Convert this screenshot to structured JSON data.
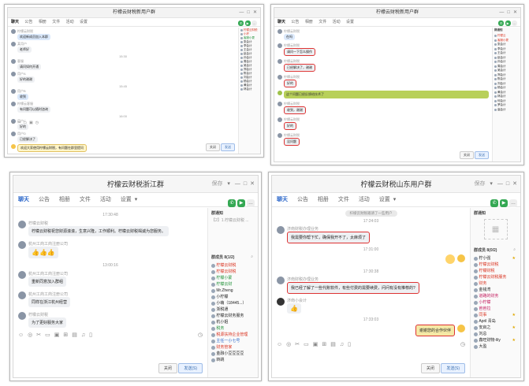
{
  "colors": {
    "accent": "#2a66c9",
    "green": "#34a853",
    "highlight_border": "#dd3333",
    "bubble": "#eef0f3",
    "self_bubble": "#f5e9a6"
  },
  "panel1": {
    "title": "柠檬云财税新用户群",
    "tabs": [
      "聊天",
      "公告",
      "相册",
      "文件",
      "活动",
      "设置"
    ],
    "timestamps": [
      "15:30",
      "15:45",
      "16:00"
    ],
    "messages": [
      {
        "name": "柠檬云财税",
        "text": "欢迎新成员加入本群"
      },
      {
        "name": "某用户",
        "text": "老师好"
      },
      {
        "name": "客服",
        "text": "请问如何开通"
      },
      {
        "name": "用户A",
        "text": "好的谢谢"
      },
      {
        "name": "用户B",
        "text": "收到"
      },
      {
        "name": "柠檬云客服",
        "text": "有问题可以随时咨询"
      },
      {
        "name": "用户C",
        "text": "好的"
      },
      {
        "name": "用户D",
        "text": "已经解决了"
      },
      {
        "name": "柠檬云",
        "text": "欢迎大家使用柠檬云财税，有问题在群里提问"
      }
    ],
    "members": [
      "柠檬云财税",
      "小柠",
      "客服小蒙",
      "张会计",
      "李会计",
      "王会计",
      "赵会计",
      "孙会计",
      "周会计",
      "吴会计",
      "郑会计",
      "陈会计",
      "刘会计",
      "杨会计",
      "黄会计",
      "林会计"
    ],
    "buttons": {
      "close": "关闭",
      "send": "发送"
    }
  },
  "panel2": {
    "title": "柠檬云财税新用户群",
    "tabs": [
      "聊天",
      "公告",
      "相册",
      "文件",
      "活动",
      "设置"
    ],
    "notice_title": "群通知",
    "messages": [
      {
        "name": "柠檬云财税",
        "text": "在吗"
      },
      {
        "name": "柠檬云财税",
        "text": "请问一下怎么操作"
      },
      {
        "name": "柠檬云财税",
        "text": "已经解决了，谢谢"
      },
      {
        "name": "柠檬云财税",
        "text": "好的"
      },
      {
        "name": "柠檬云财税",
        "text": "这个问题已经反馈给技术了"
      },
      {
        "name": "柠檬云财税",
        "text": "收到，谢谢"
      },
      {
        "name": "柠檬云财税",
        "text": "好的"
      },
      {
        "name": "柠檬云财税",
        "text": "没问题"
      }
    ],
    "members": [
      "柠檬云",
      "客服小蒙",
      "张会计",
      "李会计",
      "王会计",
      "赵会计",
      "孙会计",
      "周会计",
      "吴会计",
      "郑会计",
      "陈会计",
      "刘会计",
      "杨会计",
      "黄会计",
      "林会计",
      "何会计",
      "罗会计",
      "高会计"
    ],
    "buttons": {
      "close": "关闭",
      "send": "发送"
    }
  },
  "panel3": {
    "title": "柠檬云财税浙江群",
    "tabs": [
      "聊天",
      "公告",
      "相册",
      "文件",
      "活动",
      "设置"
    ],
    "win_label": "保存",
    "timestamps": [
      "17:30:48",
      "13:00:16"
    ],
    "messages": [
      {
        "name": "柠檬云财税",
        "text": "柠檬云财税祝您财源滚滚，生意兴隆，工作顺利。柠檬云财税竭诚为您服务。"
      },
      {
        "name": "杭州工商工商注册公司",
        "text": "👍👍👍"
      },
      {
        "name": "杭州工商工商注册公司",
        "text": "重新同意加入群组"
      },
      {
        "name": "杭州工商工商注册公司",
        "text": "同样在浙江杭州经营"
      },
      {
        "name": "柠檬云财税",
        "text": "为了更好服务大家"
      }
    ],
    "notice_title": "群通知",
    "notice_text": "【2】1.柠檬云财税 ...",
    "members_header": "群成员 8(1/2)",
    "members": [
      "柠檬云财税",
      "柠檬云财税",
      "柠檬小蒙",
      "柠檬云财",
      "Mr.Zheng",
      "小柠檬",
      "小萌（18445...）",
      "浙税通",
      "柠檬云财务服务",
      "杭小姐",
      "税务",
      "税源扶持企业管理",
      "主任一小七号",
      "财务管家",
      "金融小豆豆豆豆",
      "转跳"
    ],
    "buttons": {
      "close": "关闭",
      "send": "发送(S)"
    }
  },
  "panel4": {
    "title": "柠檬云财税山东用户群",
    "tabs": [
      "聊天",
      "公告",
      "相册",
      "文件",
      "活动",
      "设置"
    ],
    "win_label": "保存",
    "sys_msg": "柠檬云财税邀请了一些用户",
    "timestamps": [
      "17:24:03",
      "17:31:00",
      "17:30:38",
      "17:33:03"
    ],
    "messages": [
      {
        "name": "济南财税办理业务",
        "text": "我需要你帮下忙，确保我开不了，太麻烦了"
      },
      {
        "name": "济南财税办理业务",
        "text": "我已经了解了一些代账软件，有些付费的需要续费，问问有没有推荐的?"
      },
      {
        "name": "济南小会计",
        "text": "👍"
      },
      {
        "name": "我",
        "text": "谢谢您的合作伙伴"
      }
    ],
    "notice_title": "群通知",
    "members_header": "群成员 8(0/2)",
    "members": [
      "柠小强",
      "柠檬云财税",
      "柠檬财税",
      "柠檬云财税服务",
      "财务",
      "金钱湾",
      "道路的财务",
      "小柠檬",
      "芭芭拉",
      "同事",
      "April 青岛",
      "安启之",
      "刘总",
      "鑫旺财物-lily",
      "大盈"
    ],
    "buttons": {
      "close": "关闭",
      "send": "发送(S)"
    }
  }
}
